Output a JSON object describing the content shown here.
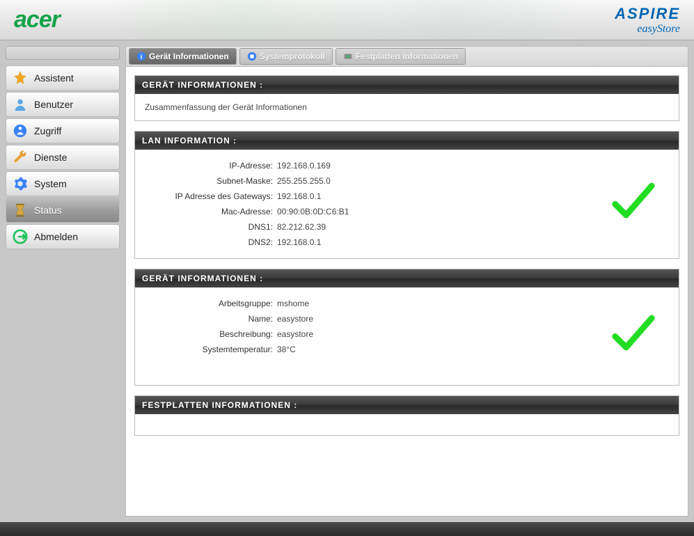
{
  "branding": {
    "acer": "acer",
    "aspire": "ASPIRE",
    "easystore": "easyStore"
  },
  "nav": {
    "items": [
      {
        "label": "Assistent"
      },
      {
        "label": "Benutzer"
      },
      {
        "label": "Zugriff"
      },
      {
        "label": "Dienste"
      },
      {
        "label": "System"
      },
      {
        "label": "Status"
      },
      {
        "label": "Abmelden"
      }
    ]
  },
  "tabs": {
    "items": [
      {
        "label": "Gerät Informationen"
      },
      {
        "label": "Systemprotokoll"
      },
      {
        "label": "Festplatten Informationen"
      }
    ]
  },
  "sections": {
    "device_header": "GERÄT INFORMATIONEN :",
    "device_summary": "Zusammenfassung der Gerät Informationen",
    "lan_header": "LAN INFORMATION :",
    "lan": [
      {
        "label": "IP-Adresse:",
        "value": "192.168.0.169"
      },
      {
        "label": "Subnet-Maske:",
        "value": "255.255.255.0"
      },
      {
        "label": "IP Adresse des Gateways:",
        "value": "192.168.0.1"
      },
      {
        "label": "Mac-Adresse:",
        "value": "00:90:0B:0D:C6:B1"
      },
      {
        "label": "DNS1:",
        "value": "82.212.62.39"
      },
      {
        "label": "DNS2:",
        "value": "192.168.0.1"
      }
    ],
    "device2_header": "GERÄT INFORMATIONEN :",
    "device2": [
      {
        "label": "Arbeitsgruppe:",
        "value": "mshome"
      },
      {
        "label": "Name:",
        "value": "easystore"
      },
      {
        "label": "Beschreibung:",
        "value": "easystore"
      },
      {
        "label": "Systemtemperatur:",
        "value": "38°C"
      }
    ],
    "disk_header": "FESTPLATTEN INFORMATIONEN :"
  }
}
